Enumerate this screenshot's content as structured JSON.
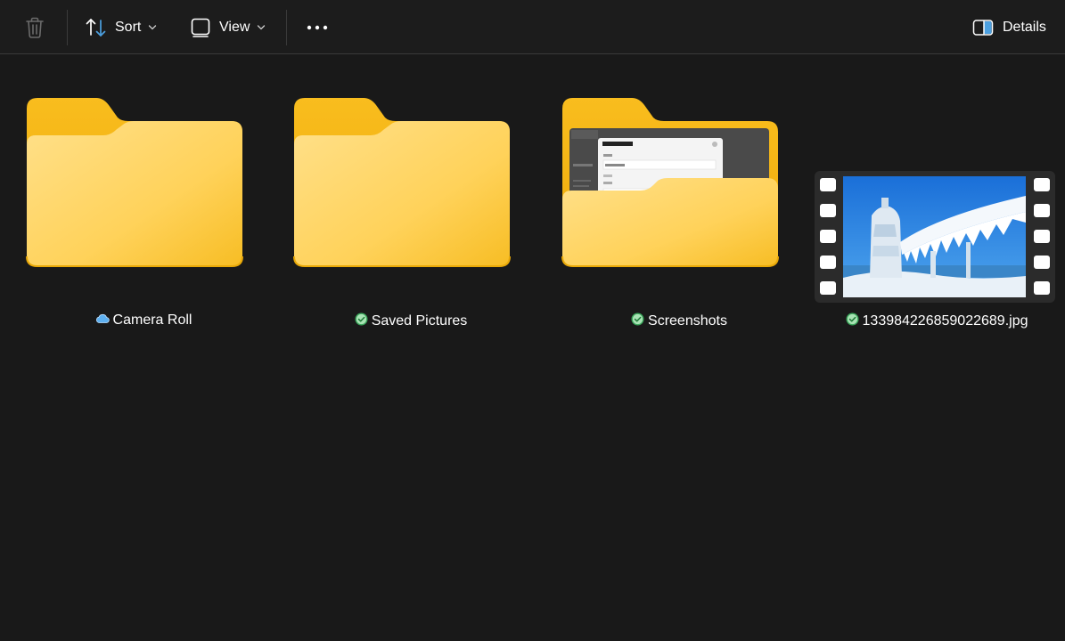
{
  "toolbar": {
    "delete_icon": "trash-icon",
    "sort": {
      "label": "Sort",
      "icon": "sort-arrows-icon"
    },
    "view": {
      "label": "View",
      "icon": "view-square-icon"
    },
    "more_icon": "more-dots-icon",
    "details": {
      "label": "Details",
      "icon": "details-pane-icon"
    }
  },
  "items": [
    {
      "name": "Camera Roll",
      "kind": "folder",
      "status": "cloud-icon"
    },
    {
      "name": "Saved Pictures",
      "kind": "folder",
      "status": "synced-check-icon"
    },
    {
      "name": "Screenshots",
      "kind": "folder-with-preview",
      "status": "synced-check-icon"
    },
    {
      "name": "133984226859022689.jpg",
      "kind": "video-thumbnail",
      "status": "synced-check-icon"
    }
  ],
  "colors": {
    "background": "#191919",
    "folder_back": "#f5b60f",
    "folder_front": "#ffd661",
    "synced_check": "#3aa55a",
    "cloud": "#4da3e8",
    "accent_blue": "#4ca0e0"
  }
}
